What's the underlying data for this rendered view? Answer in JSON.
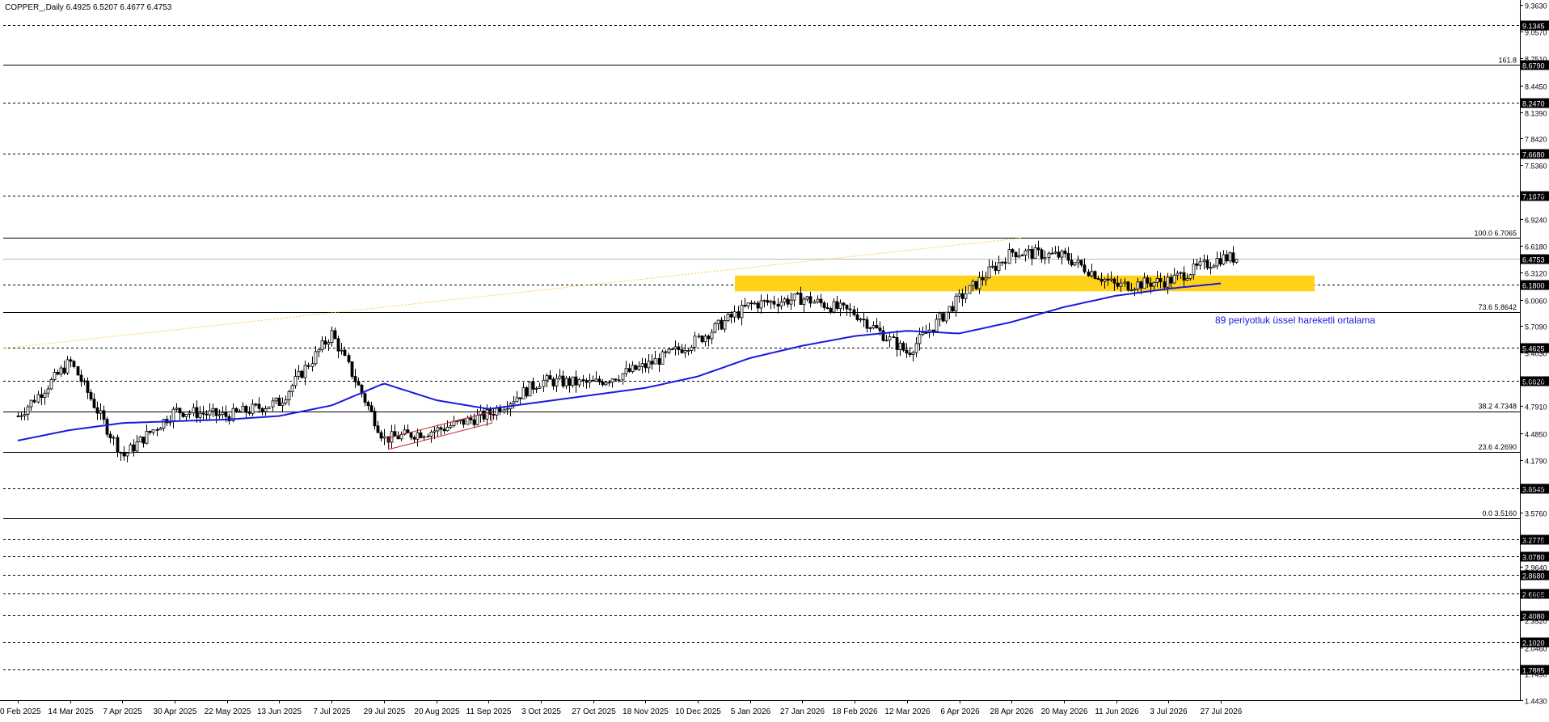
{
  "header": {
    "symbol_line": "COPPER_,Daily  6.4925 6.5207 6.4677 6.4753"
  },
  "chart_data": {
    "type": "candlestick",
    "symbol": "COPPER_",
    "timeframe": "Daily",
    "ohlc_current": {
      "open": 6.4925,
      "high": 6.5207,
      "low": 6.4677,
      "close": 6.4753
    },
    "ylim": [
      1.443,
      9.363
    ],
    "y_ticks": [
      "9.3630",
      "9.0570",
      "8.7510",
      "8.4450",
      "8.1390",
      "7.8420",
      "7.5360",
      "7.2210",
      "6.9240",
      "6.6180",
      "6.3120",
      "6.0060",
      "5.7090",
      "5.4030",
      "5.0970",
      "4.7910",
      "4.4850",
      "4.1790",
      "3.8820",
      "3.5760",
      "3.2700",
      "2.9640",
      "2.6580",
      "2.3520",
      "2.0460",
      "1.7490",
      "1.4430"
    ],
    "x_ticks": [
      "20 Feb 2025",
      "14 Mar 2025",
      "7 Apr 2025",
      "30 Apr 2025",
      "22 May 2025",
      "13 Jun 2025",
      "7 Jul 2025",
      "29 Jul 2025",
      "20 Aug 2025",
      "11 Sep 2025",
      "3 Oct 2025",
      "27 Oct 2025",
      "18 Nov 2025",
      "10 Dec 2025",
      "5 Jan 2026",
      "27 Jan 2026",
      "18 Feb 2026",
      "12 Mar 2026",
      "6 Apr 2026",
      "28 Apr 2026",
      "20 May 2026",
      "11 Jun 2026",
      "3 Jul 2026",
      "27 Jul 2026"
    ],
    "horizontal_levels": [
      {
        "value": 9.1345,
        "label": "9.1345",
        "style": "dashed"
      },
      {
        "value": 8.679,
        "label": "8.6790",
        "style": "solid"
      },
      {
        "value": 8.247,
        "label": "8.2470",
        "style": "dashed"
      },
      {
        "value": 7.668,
        "label": "7.6680",
        "style": "dashed"
      },
      {
        "value": 7.187,
        "label": "7.1870",
        "style": "dashed"
      },
      {
        "value": 6.7065,
        "label": "",
        "style": "solid"
      },
      {
        "value": 6.4753,
        "label": "6.4753",
        "style": "price"
      },
      {
        "value": 6.18,
        "label": "6.1800",
        "style": "dashed"
      },
      {
        "value": 5.8642,
        "label": "",
        "style": "solid"
      },
      {
        "value": 5.4625,
        "label": "5.4625",
        "style": "dashed"
      },
      {
        "value": 5.082,
        "label": "5.0820",
        "style": "dashed"
      },
      {
        "value": 4.7348,
        "label": "",
        "style": "solid"
      },
      {
        "value": 4.269,
        "label": "",
        "style": "solid"
      },
      {
        "value": 3.8545,
        "label": "3.8545",
        "style": "dashed"
      },
      {
        "value": 3.516,
        "label": "",
        "style": "solid"
      },
      {
        "value": 3.2775,
        "label": "3.2775",
        "style": "dashed"
      },
      {
        "value": 3.078,
        "label": "3.0780",
        "style": "dashed"
      },
      {
        "value": 2.868,
        "label": "2.8680",
        "style": "dashed"
      },
      {
        "value": 2.6605,
        "label": "2.6605",
        "style": "dashed"
      },
      {
        "value": 2.408,
        "label": "2.4080",
        "style": "dashed"
      },
      {
        "value": 2.102,
        "label": "2.1020",
        "style": "dashed"
      },
      {
        "value": 1.7885,
        "label": "1.7885",
        "style": "dashed"
      }
    ],
    "fibonacci": [
      {
        "level": "161.8",
        "value": 8.679,
        "text": "161.8"
      },
      {
        "level": "100.0",
        "value": 6.7065,
        "text": "100.0 6.7065"
      },
      {
        "level": "73.6",
        "value": 5.8642,
        "text": "73.6 5.8642"
      },
      {
        "level": "38.2",
        "value": 4.7348,
        "text": "38.2 4.7348"
      },
      {
        "level": "23.6",
        "value": 4.269,
        "text": "23.6 4.2690"
      },
      {
        "level": "0.0",
        "value": 3.516,
        "text": "0.0 3.5160"
      }
    ],
    "support_zone": {
      "from": 6.1,
      "to": 6.28
    },
    "annotation": "89 periyotluk üssel hareketli ortalama",
    "colors": {
      "ema": "#1a1adb",
      "zone": "#ffd21a",
      "trendline": "#ffc94d",
      "channel": "#c0282f",
      "candle": "#000000"
    },
    "ema_89": [
      [
        "20 Feb 2025",
        4.4
      ],
      [
        "14 Mar 2025",
        4.52
      ],
      [
        "7 Apr 2025",
        4.6
      ],
      [
        "30 Apr 2025",
        4.62
      ],
      [
        "22 May 2025",
        4.64
      ],
      [
        "13 Jun 2025",
        4.68
      ],
      [
        "7 Jul 2025",
        4.8
      ],
      [
        "29 Jul 2025",
        5.05
      ],
      [
        "20 Aug 2025",
        4.86
      ],
      [
        "11 Sep 2025",
        4.76
      ],
      [
        "3 Oct 2025",
        4.84
      ],
      [
        "27 Oct 2025",
        4.92
      ],
      [
        "18 Nov 2025",
        5.0
      ],
      [
        "10 Dec 2025",
        5.13
      ],
      [
        "5 Jan 2026",
        5.34
      ],
      [
        "27 Jan 2026",
        5.48
      ],
      [
        "18 Feb 2026",
        5.59
      ],
      [
        "12 Mar 2026",
        5.65
      ],
      [
        "6 Apr 2026",
        5.62
      ],
      [
        "28 Apr 2026",
        5.75
      ],
      [
        "20 May 2026",
        5.92
      ],
      [
        "11 Jun 2026",
        6.05
      ],
      [
        "3 Jul 2026",
        6.13
      ],
      [
        "27 Jul 2026",
        6.19
      ]
    ],
    "price_path": [
      [
        "20 Feb 2025",
        4.68
      ],
      [
        "14 Mar 2025",
        5.3
      ],
      [
        "7 Apr 2025",
        4.22
      ],
      [
        "30 Apr 2025",
        4.74
      ],
      [
        "22 May 2025",
        4.68
      ],
      [
        "13 Jun 2025",
        4.84
      ],
      [
        "7 Jul 2025",
        5.62
      ],
      [
        "29 Jul 2025",
        4.42
      ],
      [
        "20 Aug 2025",
        4.52
      ],
      [
        "11 Sep 2025",
        4.7
      ],
      [
        "3 Oct 2025",
        5.08
      ],
      [
        "27 Oct 2025",
        5.05
      ],
      [
        "18 Nov 2025",
        5.25
      ],
      [
        "10 Dec 2025",
        5.55
      ],
      [
        "5 Jan 2026",
        5.95
      ],
      [
        "27 Jan 2026",
        6.02
      ],
      [
        "18 Feb 2026",
        5.85
      ],
      [
        "12 Mar 2026",
        5.4
      ],
      [
        "6 Apr 2026",
        6.02
      ],
      [
        "28 Apr 2026",
        6.55
      ],
      [
        "20 May 2026",
        6.5
      ],
      [
        "11 Jun 2026",
        6.16
      ],
      [
        "3 Jul 2026",
        6.22
      ],
      [
        "27 Jul 2026",
        6.48
      ]
    ]
  }
}
